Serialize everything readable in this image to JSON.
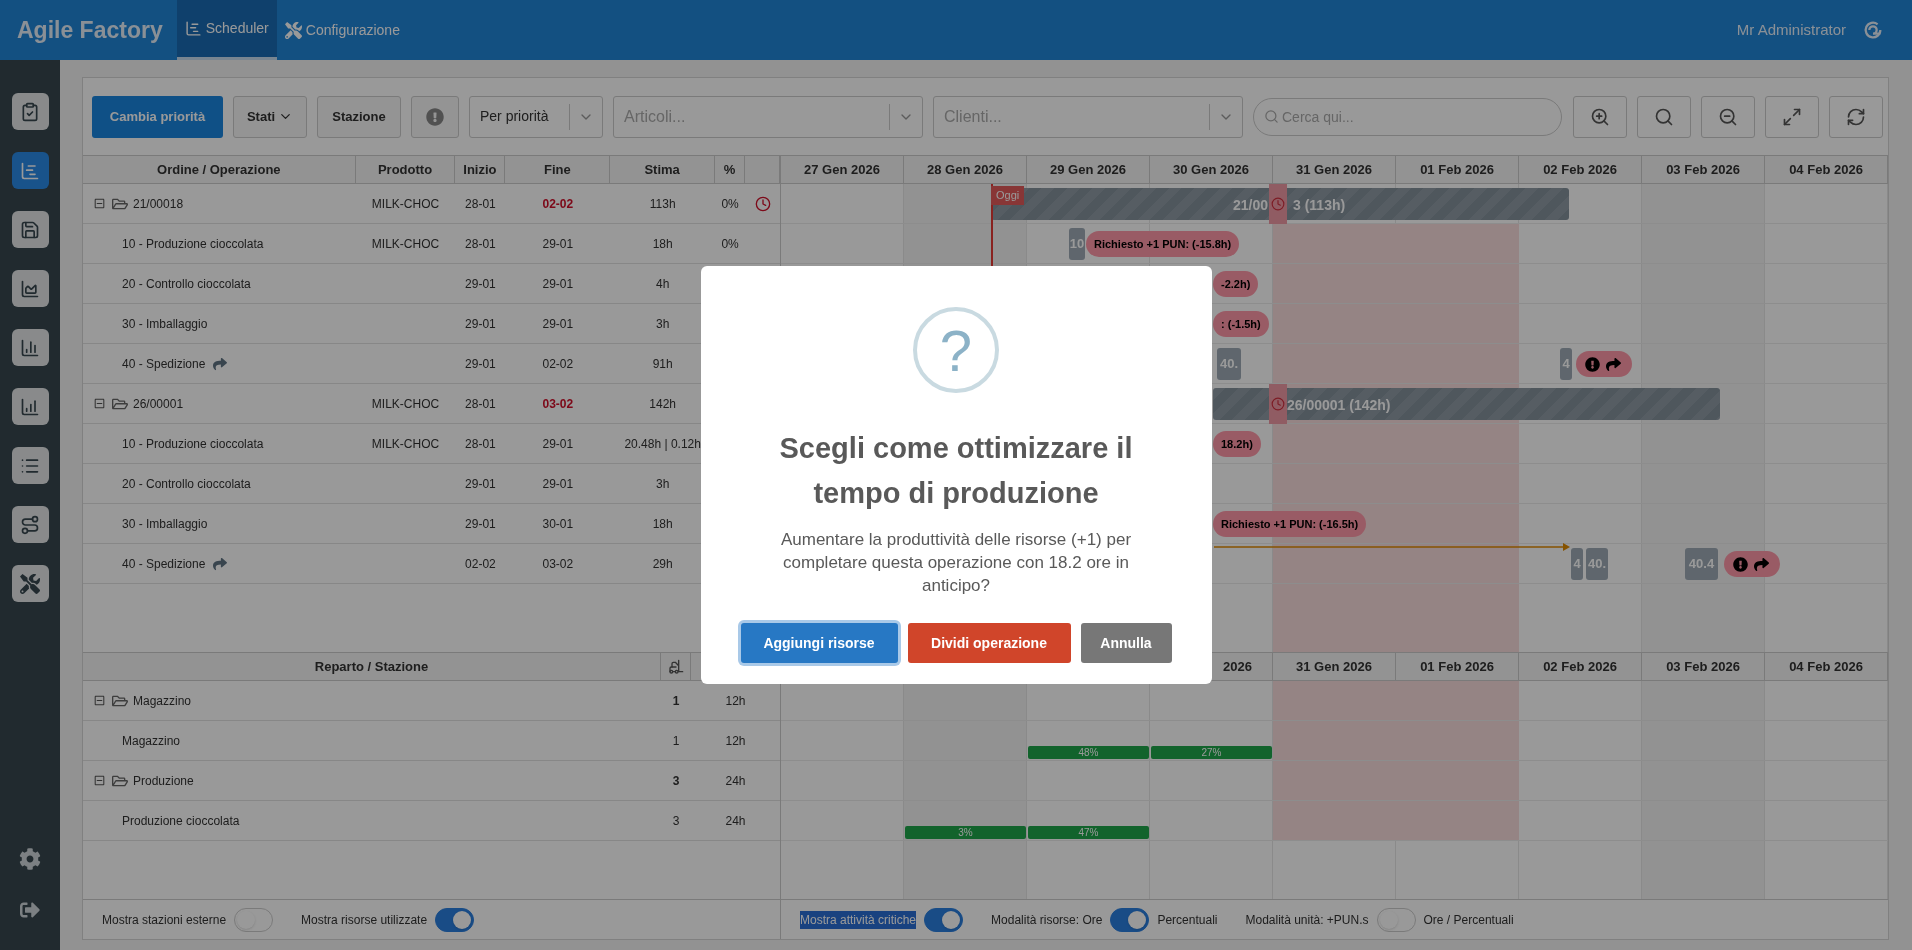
{
  "app": {
    "title": "Agile Factory",
    "user": "Mr Administrator",
    "tabs": [
      {
        "label": "Scheduler",
        "kind": "scheduler",
        "selected": true
      },
      {
        "label": "Configurazione",
        "kind": "tools",
        "selected": false
      }
    ]
  },
  "sidebar": {
    "items": [
      {
        "kind": "clipboard",
        "selected": false
      },
      {
        "kind": "scheduler",
        "selected": true
      },
      {
        "kind": "save",
        "selected": false
      },
      {
        "kind": "area",
        "selected": false
      },
      {
        "kind": "bars",
        "selected": false
      },
      {
        "kind": "growth",
        "selected": false
      },
      {
        "kind": "list",
        "selected": false
      },
      {
        "kind": "route",
        "selected": false
      },
      {
        "kind": "tools",
        "selected": false
      }
    ],
    "bottom": [
      {
        "kind": "settings"
      },
      {
        "kind": "logout"
      }
    ]
  },
  "toolbar": {
    "buttons": [
      {
        "kind": "primary",
        "label": "Cambia priorità"
      },
      {
        "kind": "dropdown",
        "label": "Stati"
      },
      {
        "kind": "plain",
        "label": "Stazione"
      },
      {
        "kind": "alert"
      }
    ],
    "sort_select": {
      "value": "Per priorità"
    },
    "articles_select": {
      "placeholder": "Articoli..."
    },
    "clients_select": {
      "placeholder": "Clienti..."
    },
    "search": {
      "placeholder": "Cerca qui..."
    },
    "view_buttons": [
      {
        "kind": "zoom-in"
      },
      {
        "kind": "search"
      },
      {
        "kind": "zoom-out"
      },
      {
        "kind": "fit"
      },
      {
        "kind": "refresh"
      }
    ]
  },
  "orders": {
    "columns": [
      "Ordine / Operazione",
      "Prodotto",
      "Inizio",
      "Fine",
      "Stima",
      "%"
    ],
    "rows": [
      {
        "kind": "order",
        "expanded": true,
        "name": "21/00018",
        "product": "MILK-CHOC",
        "start": "28-01",
        "end": "02-02",
        "overdue": true,
        "estimate": "113h",
        "percent": "0%",
        "delayed": true,
        "moved": false
      },
      {
        "kind": "operation",
        "name": "10 - Produzione cioccolata",
        "product": "MILK-CHOC",
        "start": "28-01",
        "end": "29-01",
        "overdue": false,
        "estimate": "18h",
        "percent": "0%",
        "delayed": false,
        "moved": false
      },
      {
        "kind": "operation",
        "name": "20 - Controllo cioccolata",
        "start": "29-01",
        "end": "29-01",
        "overdue": false,
        "estimate": "4h",
        "delayed": false,
        "moved": false
      },
      {
        "kind": "operation",
        "name": "30 - Imballaggio",
        "start": "29-01",
        "end": "29-01",
        "overdue": false,
        "estimate": "3h",
        "delayed": false,
        "moved": false
      },
      {
        "kind": "operation",
        "name": "40 - Spedizione",
        "start": "29-01",
        "end": "02-02",
        "overdue": false,
        "estimate": "91h",
        "delayed": false,
        "moved": true
      },
      {
        "kind": "order",
        "expanded": true,
        "name": "26/00001",
        "product": "MILK-CHOC",
        "start": "28-01",
        "end": "03-02",
        "overdue": true,
        "estimate": "142h",
        "delayed": false,
        "moved": false
      },
      {
        "kind": "operation",
        "name": "10 - Produzione cioccolata",
        "product": "MILK-CHOC",
        "start": "28-01",
        "end": "29-01",
        "overdue": false,
        "estimate": "20.48h | 0.12h",
        "delayed": false,
        "moved": false
      },
      {
        "kind": "operation",
        "name": "20 - Controllo cioccolata",
        "start": "29-01",
        "end": "29-01",
        "overdue": false,
        "estimate": "3h",
        "delayed": false,
        "moved": false
      },
      {
        "kind": "operation",
        "name": "30 - Imballaggio",
        "start": "29-01",
        "end": "30-01",
        "overdue": false,
        "estimate": "18h",
        "delayed": false,
        "moved": false
      },
      {
        "kind": "operation",
        "name": "40 - Spedizione",
        "start": "02-02",
        "end": "03-02",
        "overdue": false,
        "estimate": "29h",
        "delayed": false,
        "moved": true
      }
    ]
  },
  "gantt": {
    "dates": [
      "27 Gen 2026",
      "28 Gen 2026",
      "29 Gen 2026",
      "30 Gen 2026",
      "31 Gen 2026",
      "01 Feb 2026",
      "02 Feb 2026",
      "03 Feb 2026",
      "04 Feb 2026"
    ],
    "items": [
      {
        "kind": "summary",
        "label": "21/00",
        "label_tail": "3 (113h)"
      },
      {
        "kind": "today",
        "label": "Oggi"
      },
      {
        "kind": "clock"
      },
      {
        "kind": "op",
        "label": "10"
      },
      {
        "kind": "pill",
        "label": "Richiesto +1 PUN: (-15.8h)"
      },
      {
        "kind": "pill",
        "label": "-2.2h)"
      },
      {
        "kind": "pill",
        "label": ": (-1.5h)"
      },
      {
        "kind": "op",
        "label": "40."
      },
      {
        "kind": "op",
        "label": "4"
      },
      {
        "kind": "alert"
      },
      {
        "kind": "summary",
        "label": "26/00001 (142h)"
      },
      {
        "kind": "clock"
      },
      {
        "kind": "pill",
        "label": "18.2h)"
      },
      {
        "kind": "pill",
        "label": "Richiesto +1 PUN: (-16.5h)"
      },
      {
        "kind": "link"
      },
      {
        "kind": "op",
        "label": "4"
      },
      {
        "kind": "op",
        "label": "40."
      },
      {
        "kind": "op",
        "label": "40.4"
      },
      {
        "kind": "alert"
      }
    ]
  },
  "stations": {
    "column": "Reparto / Stazione",
    "rows": [
      {
        "kind": "group",
        "expanded": true,
        "name": "Magazzino",
        "count": "1",
        "hours": "12h",
        "load": []
      },
      {
        "kind": "station",
        "name": "Magazzino",
        "count": "1",
        "hours": "12h",
        "load": [
          "48%",
          "27%"
        ]
      },
      {
        "kind": "group",
        "expanded": true,
        "name": "Produzione",
        "count": "3",
        "hours": "24h",
        "load": []
      },
      {
        "kind": "station",
        "name": "Produzione cioccolata",
        "count": "3",
        "hours": "24h",
        "load": [
          "3%",
          "47%"
        ]
      }
    ],
    "dates": [
      "2026",
      "31 Gen 2026",
      "01 Feb 2026",
      "02 Feb 2026",
      "03 Feb 2026",
      "04 Feb 2026"
    ]
  },
  "footer": {
    "left": [
      {
        "label": "Mostra stazioni esterne",
        "on": false,
        "highlighted": false
      },
      {
        "label": "Mostra risorse utilizzate",
        "on": true,
        "highlighted": false
      }
    ],
    "right": [
      {
        "label": "Mostra attività critiche",
        "on": true,
        "highlighted": true
      },
      {
        "label": "Modalità risorse: Ore",
        "on": true,
        "highlighted": false,
        "after": "Percentuali"
      },
      {
        "label": "Modalità unità: +PUN.s",
        "on": false,
        "highlighted": false,
        "after": "Ore / Percentuali"
      }
    ]
  },
  "modal": {
    "icon": "?",
    "title": "Scegli come ottimizzare il tempo di produzione",
    "message": "Aumentare la produttività delle risorse (+1) per completare questa operazione con 18.2 ore in anticipo?",
    "buttons": [
      {
        "kind": "primary",
        "label": "Aggiungi risorse",
        "focused": true
      },
      {
        "kind": "danger",
        "label": "Dividi operazione",
        "focused": false
      },
      {
        "kind": "secondary",
        "label": "Annulla",
        "focused": false
      }
    ]
  }
}
